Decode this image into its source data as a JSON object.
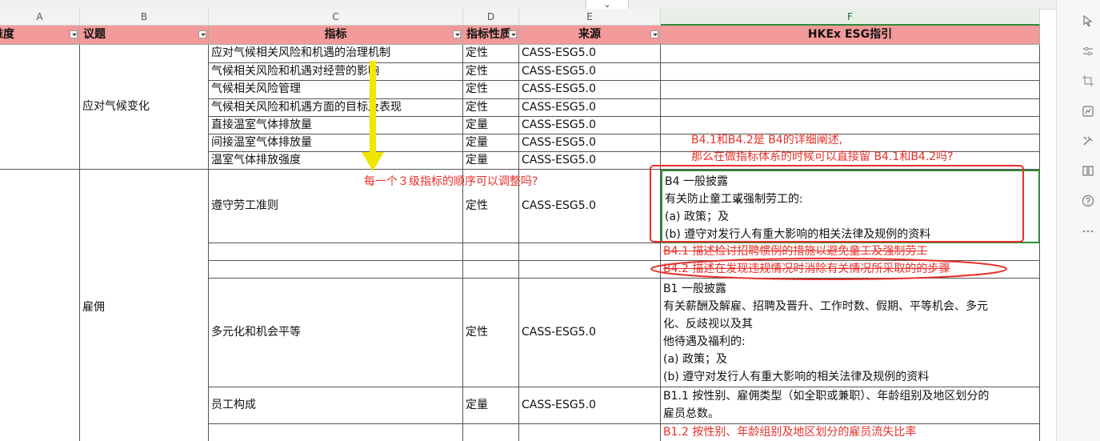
{
  "column_letters": [
    "A",
    "B",
    "C",
    "D",
    "E",
    "F"
  ],
  "collapse_arrow": "⌄",
  "header": {
    "a": "维度",
    "b": "议题",
    "c": "指标",
    "d": "指标性质",
    "e": "来源",
    "f": "HKEx ESG指引"
  },
  "climate": {
    "topic": "应对气候变化",
    "rows": [
      {
        "indicator": "应对气候相关风险和机遇的治理机制",
        "nature": "定性",
        "source": "CASS-ESG5.0"
      },
      {
        "indicator": "气候相关风险和机遇对经营的影响",
        "nature": "定性",
        "source": "CASS-ESG5.0"
      },
      {
        "indicator": "气候相关风险管理",
        "nature": "定性",
        "source": "CASS-ESG5.0"
      },
      {
        "indicator": "气候相关风险和机遇方面的目标及表现",
        "nature": "定性",
        "source": "CASS-ESG5.0"
      },
      {
        "indicator": "直接温室气体排放量",
        "nature": "定量",
        "source": "CASS-ESG5.0"
      },
      {
        "indicator": "间接温室气体排放量",
        "nature": "定量",
        "source": "CASS-ESG5.0"
      },
      {
        "indicator": "温室气体排放强度",
        "nature": "定量",
        "source": "CASS-ESG5.0"
      }
    ]
  },
  "employment": {
    "topic": "雇佣",
    "labor": {
      "indicator": "遵守劳工准则",
      "nature": "定性",
      "source": "CASS-ESG5.0",
      "guide": [
        "B4 一般披露",
        "有关防止童工或强制劳工的:",
        "(a) 政策；及",
        "(b) 遵守对发行人有重大影响的相关法律及规例的资料"
      ]
    },
    "b41": "B4.1 描述检讨招聘惯例的措施以避免童工及强制劳工",
    "b42": "B4.2 描述在发现违规情况时消除有关情况所采取的的步骤",
    "diversity": {
      "indicator": "多元化和机会平等",
      "nature": "定性",
      "source": "CASS-ESG5.0",
      "guide": [
        "B1 一般披露",
        "有关薪酬及解雇、招聘及晋升、工作时数、假期、平等机会、多元",
        "化、反歧视以及其",
        "他待遇及福利的:",
        "(a) 政策；及",
        "(b) 遵守对发行人有重大影响的相关法律及规例的资料"
      ]
    },
    "composition": {
      "indicator": "员工构成",
      "nature": "定量",
      "source": "CASS-ESG5.0",
      "guide": [
        "B1.1 按性别、雇佣类型（如全职或兼职）、年龄组别及地区划分的",
        "雇员总数。"
      ]
    },
    "b12": "B1.2 按性别、年龄组别及地区划分的雇员流失比率"
  },
  "annotations": {
    "question1": "每一个３级指标的顺序可以调整吗?",
    "question2_line1": "B4.1和B4.2是 B4的详细阐述,",
    "question2_line2": "那么在做指标体系的时候可以直接留 B4.1和B4.2吗?"
  },
  "colors": {
    "header_fill": "#f39a9a",
    "annotation": "#e8302a",
    "arrow": "#f2e600",
    "active_col": "#2e8b3c"
  },
  "toolbar_icons": [
    "cursor-icon",
    "sliders-icon",
    "crop-icon",
    "chart-icon",
    "tools-icon",
    "book-icon",
    "help-icon",
    "more-icon"
  ]
}
